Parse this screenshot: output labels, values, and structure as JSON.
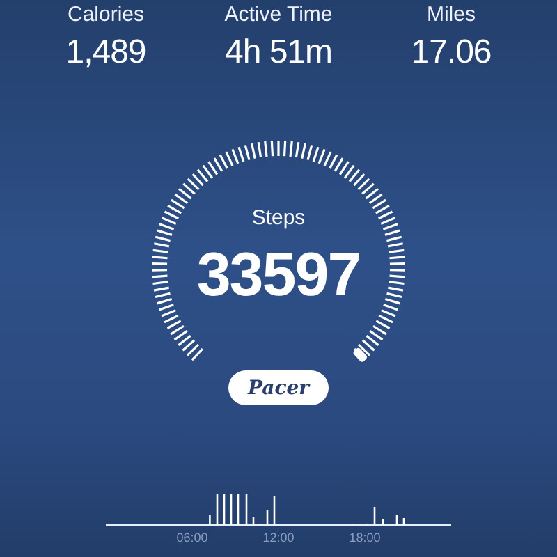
{
  "stats": [
    {
      "label": "Calories",
      "value": "1,489"
    },
    {
      "label": "Active Time",
      "value": "4h 51m"
    },
    {
      "label": "Miles",
      "value": "17.06"
    }
  ],
  "gauge": {
    "label": "Steps",
    "value": "33597"
  },
  "brand": "Pacer",
  "activity_chart": {
    "time_labels": [
      "06:00",
      "12:00",
      "18:00"
    ]
  }
}
